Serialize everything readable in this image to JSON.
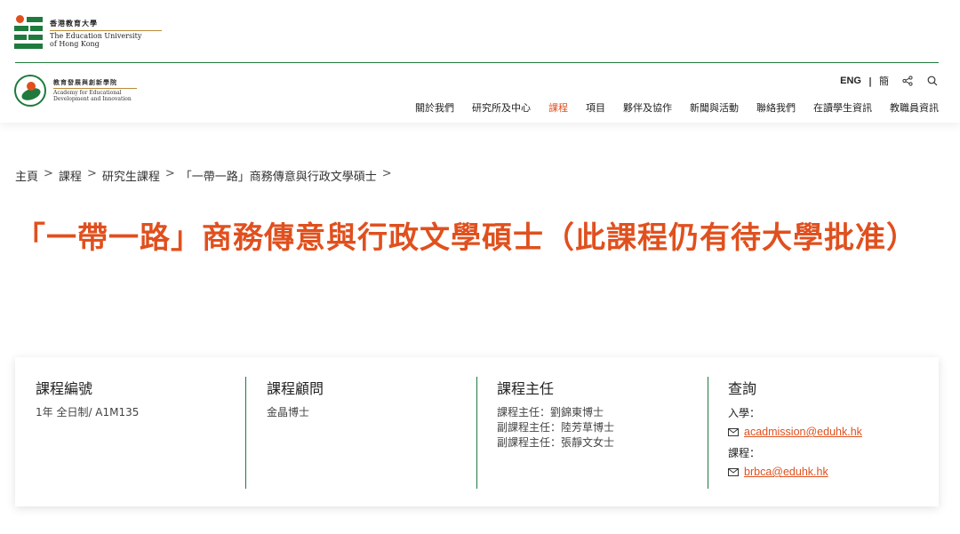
{
  "university": {
    "name_zh": "香港教育大學",
    "name_en_line1": "The Education University",
    "name_en_line2": "of Hong Kong"
  },
  "academy": {
    "name_zh": "教育發展與創新學院",
    "name_en_line1": "Academy for Educational",
    "name_en_line2": "Development and Innovation"
  },
  "utility": {
    "lang_en": "ENG",
    "separator": "|",
    "lang_sc": "簡",
    "share_icon": "share-icon",
    "search_icon": "search-icon"
  },
  "nav": {
    "items": [
      "關於我們",
      "研究所及中心",
      "課程",
      "項目",
      "夥伴及協作",
      "新聞與活動",
      "聯絡我們",
      "在讀學生資訊",
      "教職員資訊"
    ],
    "active_index": 2,
    "active_color": "#e0501e"
  },
  "breadcrumb": {
    "items": [
      "主頁",
      "課程",
      "研究生課程",
      "「一帶一路」商務傳意與行政文學碩士"
    ],
    "separator": ">"
  },
  "page_title": "「一帶一路」商務傳意與行政文學碩士（此課程仍有待大學批准）",
  "card": {
    "code": {
      "heading": "課程編號",
      "value": "1年 全日制/ A1M135"
    },
    "advisor": {
      "heading": "課程顧問",
      "value": "金晶博士"
    },
    "leaders": {
      "heading": "課程主任",
      "lines": [
        "課程主任：劉錦東博士",
        "副課程主任：陸芳草博士",
        "副課程主任：張靜文女士"
      ]
    },
    "enquiry": {
      "heading": "查詢",
      "admission_label": "入學：",
      "admission_email": "acadmission@eduhk.hk",
      "programme_label": "課程：",
      "programme_email": "brbca@eduhk.hk"
    }
  },
  "colors": {
    "accent": "#e0501e",
    "brand_green": "#1f7a3e"
  }
}
